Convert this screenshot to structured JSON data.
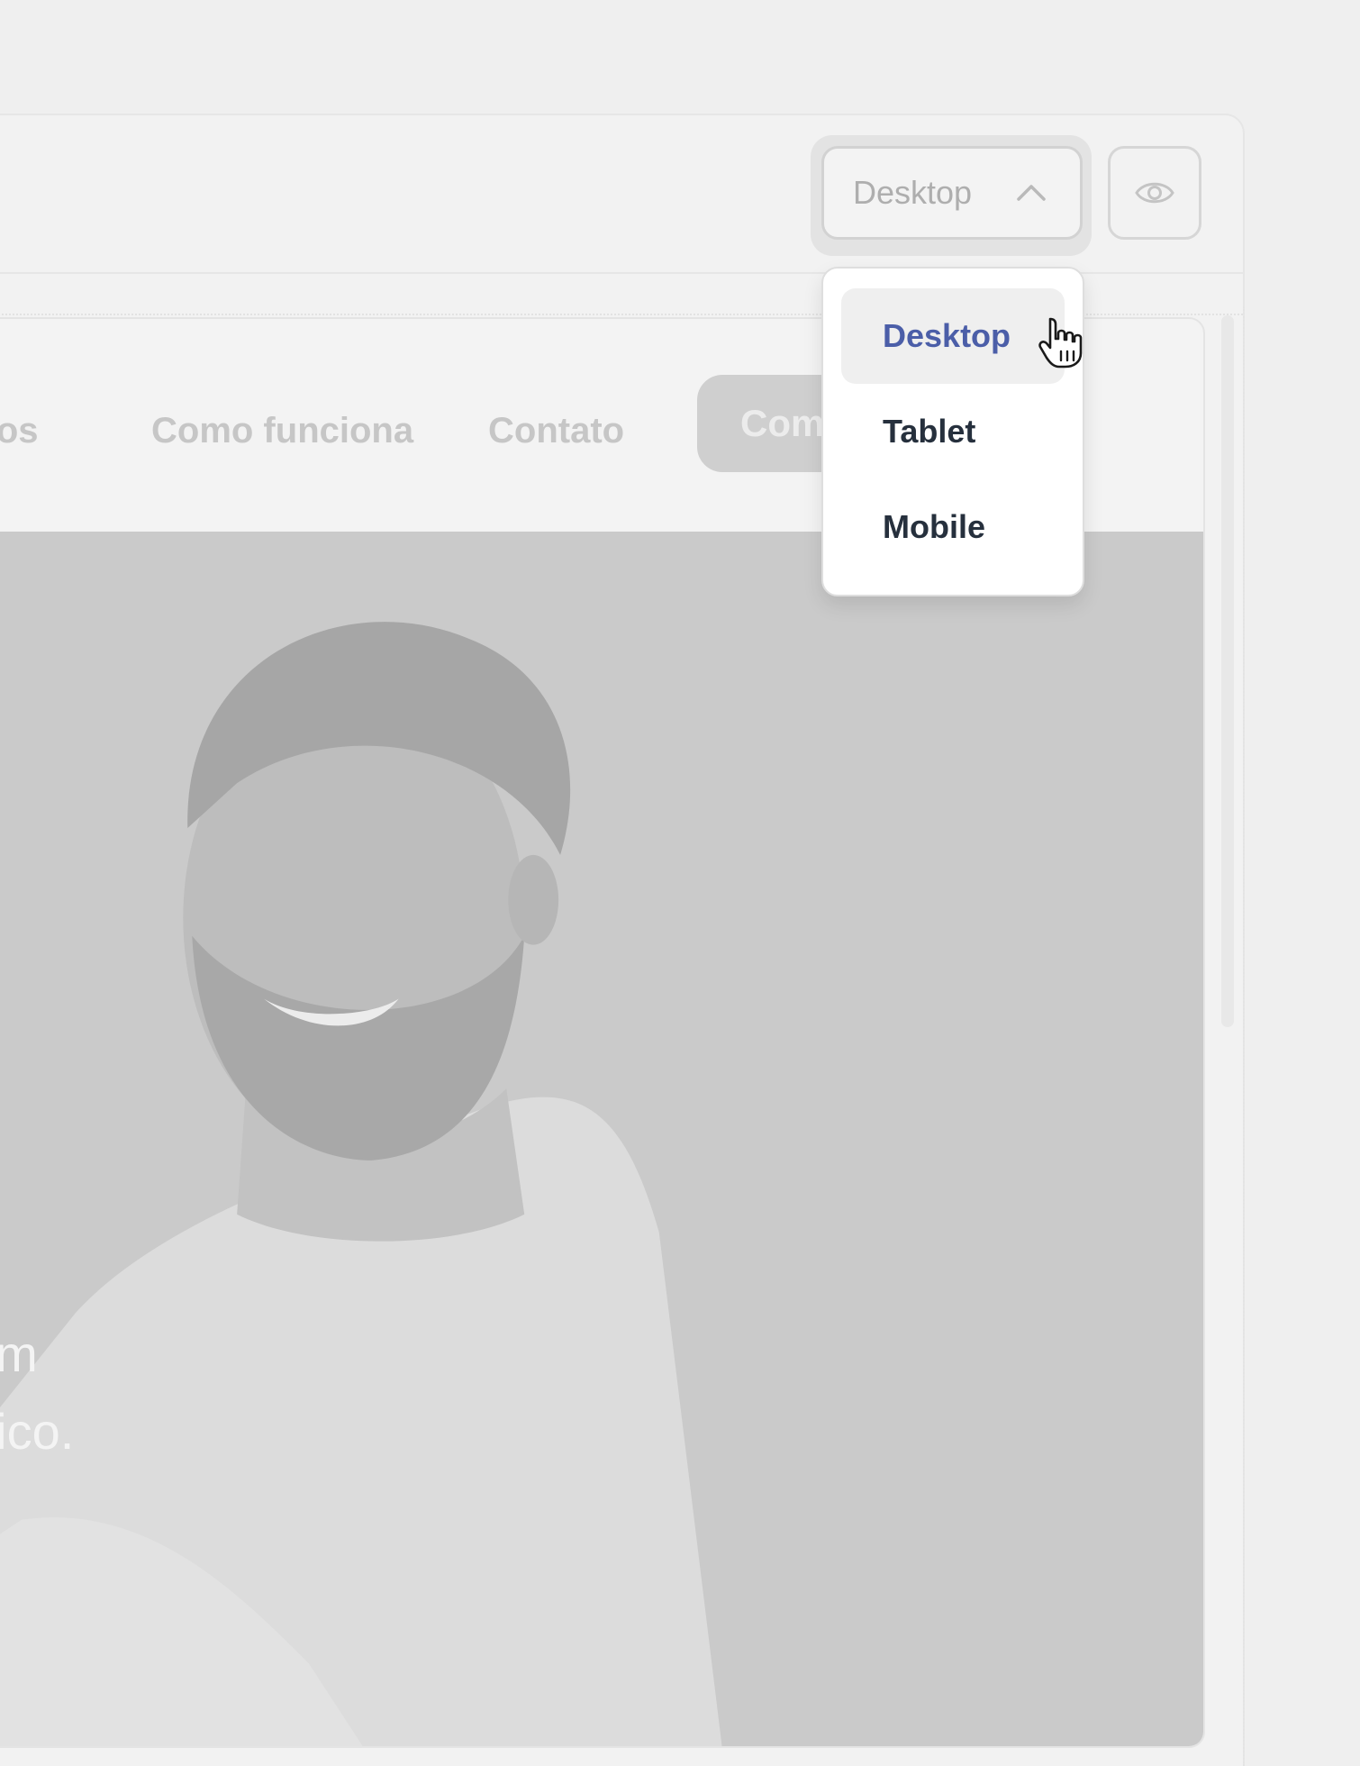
{
  "toolbar": {
    "device_select": {
      "value": "Desktop",
      "icon": "chevron-up-icon",
      "expanded": true
    },
    "preview_icon": "eye-icon"
  },
  "site_preview": {
    "nav": {
      "links": [
        "rsos",
        "Como funciona",
        "Contato"
      ],
      "cta_label": "Com"
    },
    "hero": {
      "text_lines": [
        "em",
        "nico."
      ]
    }
  },
  "dropdown": {
    "options": [
      "Desktop",
      "Tablet",
      "Mobile"
    ],
    "selected": "Desktop",
    "selected_color": "#4b5ea8"
  },
  "cursor_icon": "hand-pointer-icon"
}
